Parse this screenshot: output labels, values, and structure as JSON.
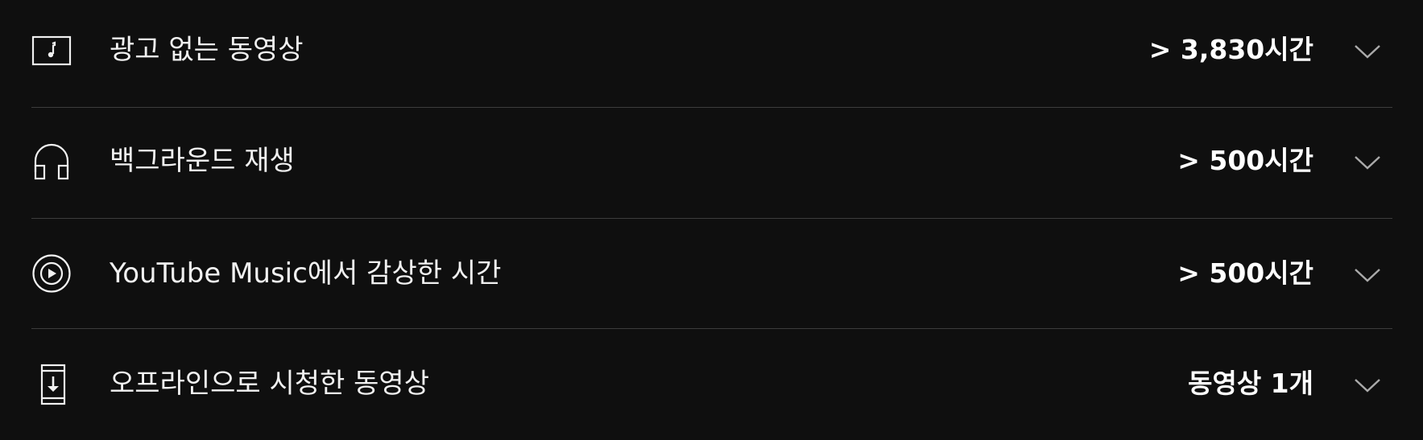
{
  "rows": [
    {
      "label": "광고 없는 동영상",
      "value": "> 3,830시간",
      "icon": "music-video-icon"
    },
    {
      "label": "백그라운드 재생",
      "value": "> 500시간",
      "icon": "headphones-icon"
    },
    {
      "label": "YouTube Music에서 감상한 시간",
      "value": "> 500시간",
      "icon": "play-circle-icon"
    },
    {
      "label": "오프라인으로 시청한 동영상",
      "value": "동영상 1개",
      "icon": "offline-download-icon"
    }
  ],
  "colors": {
    "background": "#0f0f0f",
    "text": "#f1f1f1",
    "divider": "#3d3d3d",
    "chevron": "#aaaaaa"
  }
}
